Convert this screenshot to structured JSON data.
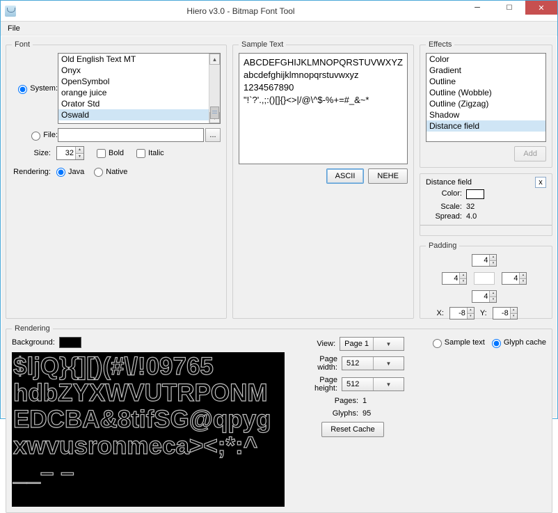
{
  "window": {
    "title": "Hiero v3.0 - Bitmap Font Tool"
  },
  "menu": {
    "file": "File"
  },
  "font": {
    "legend": "Font",
    "system_label": "System:",
    "file_label": "File:",
    "size_label": "Size:",
    "size_value": "32",
    "bold_label": "Bold",
    "italic_label": "Italic",
    "rendering_label": "Rendering:",
    "java_label": "Java",
    "native_label": "Native",
    "fonts": [
      "Old English Text MT",
      "Onyx",
      "OpenSymbol",
      "orange juice",
      "Orator Std",
      "Oswald"
    ],
    "selected_font_index": 5,
    "file_value": ""
  },
  "sample": {
    "legend": "Sample Text",
    "lines": [
      "ABCDEFGHIJKLMNOPQRSTUVWXYZ",
      "abcdefghijklmnopqrstuvwxyz",
      "1234567890",
      "\"!`?'.,;:()[]{}<>|/@\\^$-%+=#_&~*"
    ],
    "ascii_btn": "ASCII",
    "nehe_btn": "NEHE"
  },
  "effects": {
    "legend": "Effects",
    "items": [
      "Color",
      "Gradient",
      "Outline",
      "Outline (Wobble)",
      "Outline (Zigzag)",
      "Shadow",
      "Distance field"
    ],
    "selected_index": 6,
    "add_btn": "Add"
  },
  "distance_field": {
    "title": "Distance field",
    "close": "x",
    "color_label": "Color:",
    "scale_label": "Scale:",
    "scale_value": "32",
    "spread_label": "Spread:",
    "spread_value": "4.0"
  },
  "rendering": {
    "legend": "Rendering",
    "background_label": "Background:",
    "mode_sample": "Sample text",
    "mode_glyph": "Glyph cache",
    "view_label": "View:",
    "view_value": "Page 1",
    "pw_label": "Page width:",
    "pw_value": "512",
    "ph_label": "Page height:",
    "ph_value": "512",
    "pages_label": "Pages:",
    "pages_value": "1",
    "glyphs_label": "Glyphs:",
    "glyphs_value": "95",
    "reset_btn": "Reset Cache",
    "preview_lines": [
      "$ljQ}{][)(#\\/!09765",
      "hdbZYXWVUTRPONM",
      "EDCBA&8tifSG@qpyg",
      "xwvusronmeca><;*:^",
      "__– –"
    ]
  },
  "padding": {
    "legend": "Padding",
    "top": "4",
    "left": "4",
    "right": "4",
    "bottom": "4",
    "x_label": "X:",
    "y_label": "Y:",
    "x": "-8",
    "y": "-8"
  }
}
